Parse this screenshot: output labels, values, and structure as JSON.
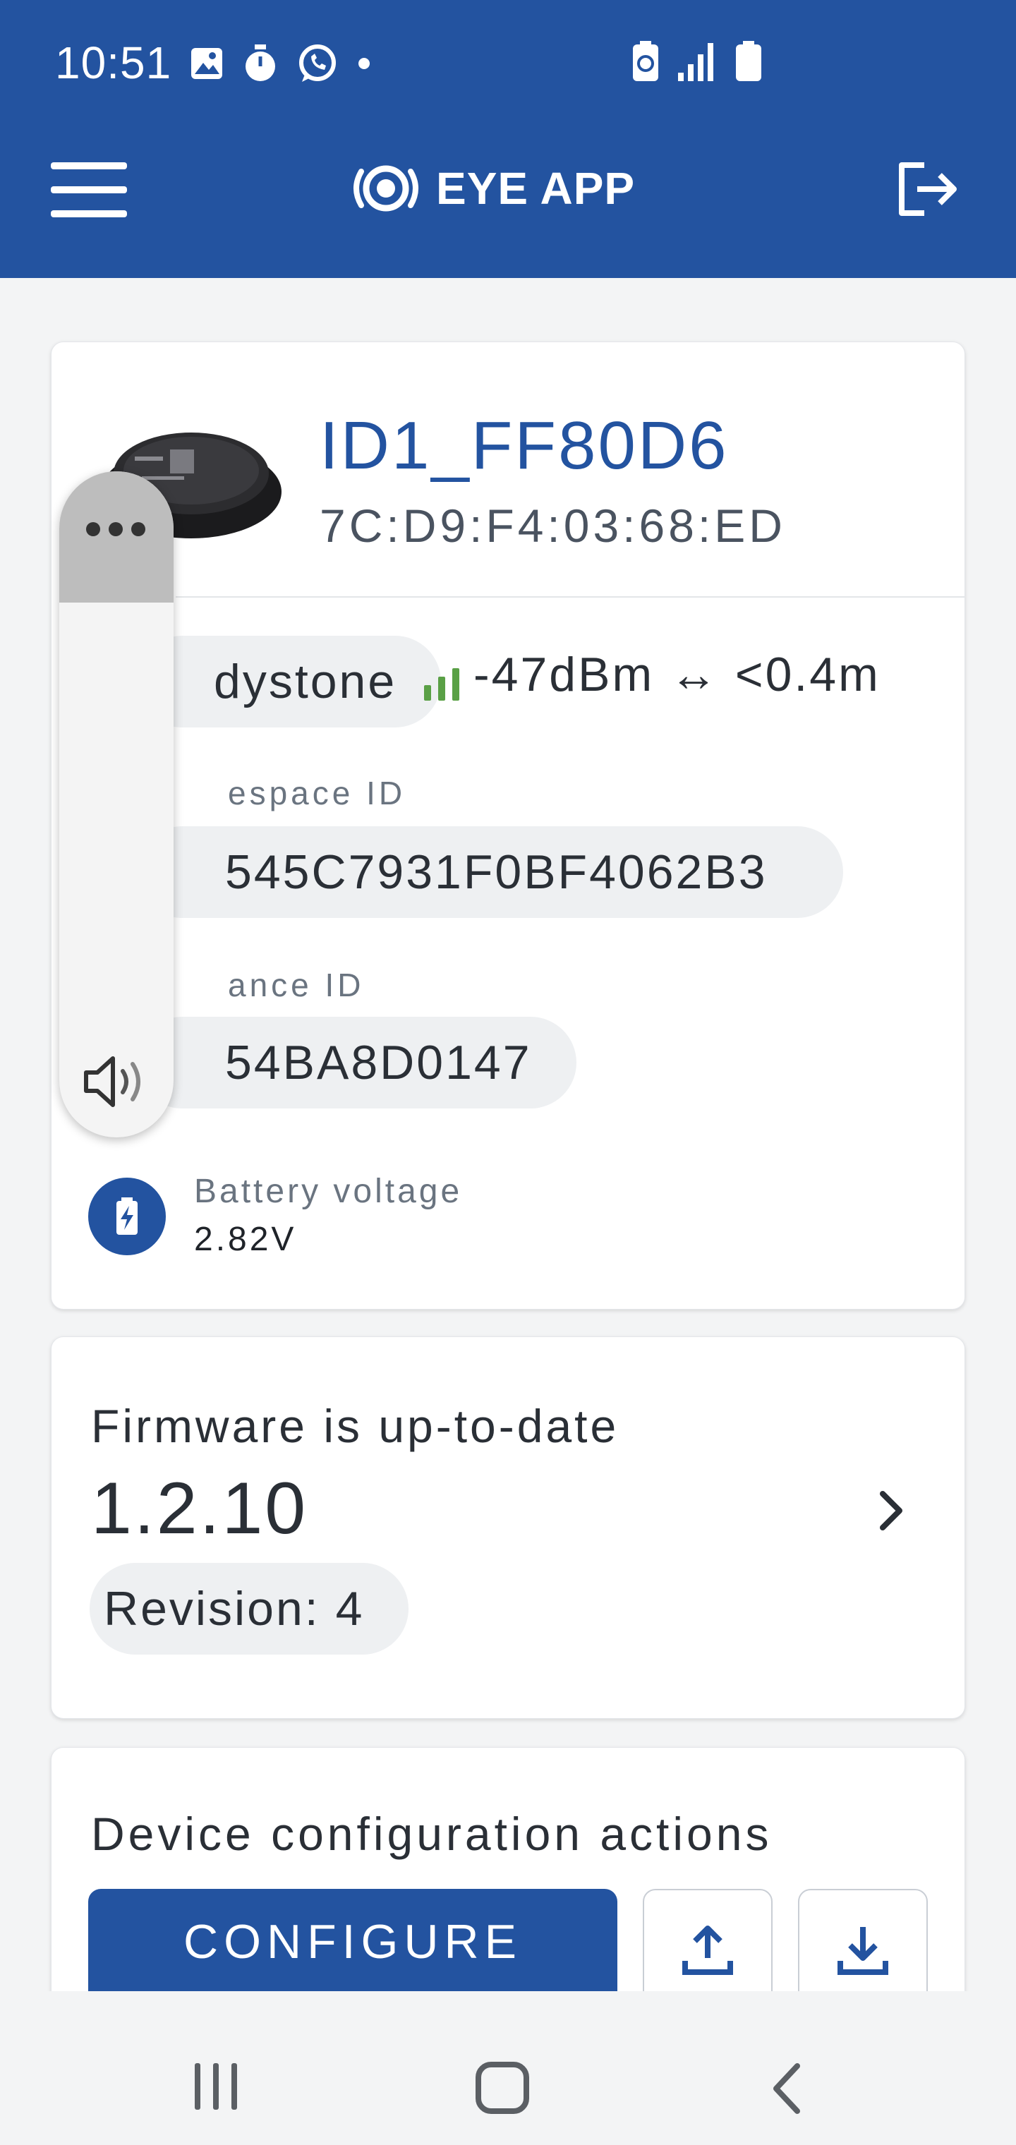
{
  "status_bar": {
    "time": "10:51",
    "icons": [
      "gallery-icon",
      "timer-icon",
      "whatsapp-icon",
      "dot-icon",
      "battery-saver-icon",
      "signal-icon",
      "battery-icon"
    ]
  },
  "app_bar": {
    "title": "EYE APP",
    "icons": [
      "menu-icon",
      "eye-logo-icon",
      "logout-icon"
    ]
  },
  "device": {
    "name": "ID1_FF80D6",
    "mac": "7C:D9:F4:03:68:ED",
    "protocol": "dystone",
    "rssi_text": "-47dBm ↔ <0.4m",
    "namespace_label": "espace ID",
    "namespace_value": "545C7931F0BF4062B3",
    "instance_label": "ance ID",
    "instance_value": "54BA8D0147",
    "battery_label": "Battery voltage",
    "battery_value": "2.82V"
  },
  "firmware": {
    "status": "Firmware is up-to-date",
    "version": "1.2.10",
    "revision": "Revision: 4"
  },
  "actions": {
    "title": "Device configuration actions",
    "configure_label": "CONFIGURE"
  },
  "colors": {
    "primary": "#2353a0",
    "signal": "#5aa046",
    "background": "#f3f4f5"
  }
}
